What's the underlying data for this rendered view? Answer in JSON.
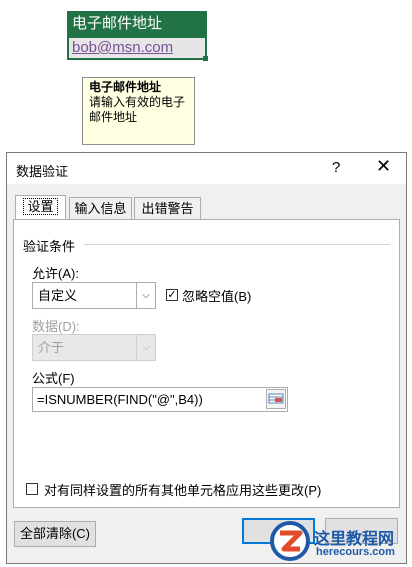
{
  "sheet": {
    "header_cell": "电子邮件地址",
    "active_cell": "bob@msn.com"
  },
  "input_message": {
    "title": "电子邮件地址",
    "line1": "请输入有效的电子",
    "line2": "邮件地址"
  },
  "dialog": {
    "title": "数据验证",
    "help": "?",
    "close": "✕",
    "tabs": [
      {
        "label": "设置"
      },
      {
        "label": "输入信息"
      },
      {
        "label": "出错警告"
      }
    ],
    "group_label": "验证条件",
    "allow_label": "允许(A):",
    "allow_value": "自定义",
    "ignore_blank_label": "忽略空值(B)",
    "ignore_blank_checked": true,
    "data_label": "数据(D):",
    "data_value": "介于",
    "formula_label": "公式(F)",
    "formula_value": "=ISNUMBER(FIND(\"@\",B4))",
    "apply_all_label": "对有同样设置的所有其他单元格应用这些更改(P)",
    "apply_all_checked": false,
    "clear_all_label": "全部清除(C)"
  },
  "watermark": {
    "line1": "这里教程网",
    "line2": "herecours.com"
  },
  "colors": {
    "excel_green": "#217346",
    "link_purple": "#7a4f9a",
    "tooltip_bg": "#ffffe1",
    "focus_blue": "#0078d7"
  }
}
